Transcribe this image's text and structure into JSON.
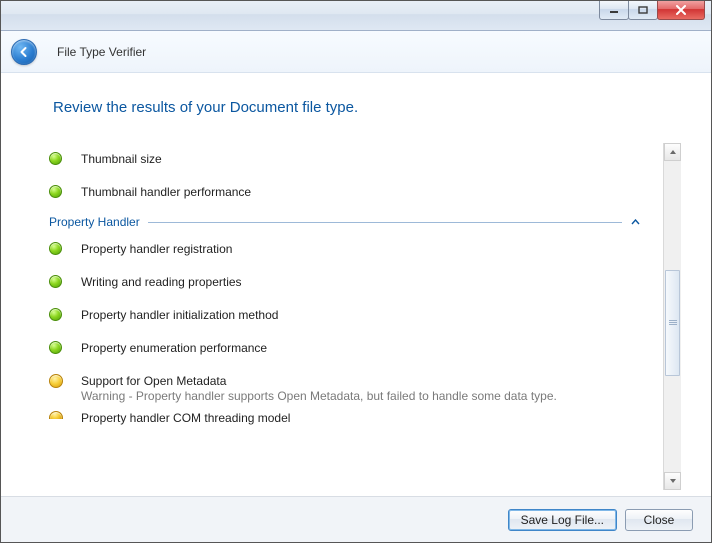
{
  "window": {
    "app_title": "File Type Verifier"
  },
  "page": {
    "heading": "Review the results of your Document file type."
  },
  "results": {
    "pre_section": [
      {
        "status": "ok",
        "title": "Thumbnail size"
      },
      {
        "status": "ok",
        "title": "Thumbnail handler performance"
      }
    ],
    "section": {
      "label": "Property Handler",
      "expanded": true
    },
    "items": [
      {
        "status": "ok",
        "title": "Property handler registration"
      },
      {
        "status": "ok",
        "title": "Writing and reading properties"
      },
      {
        "status": "ok",
        "title": "Property handler initialization method"
      },
      {
        "status": "ok",
        "title": "Property enumeration performance"
      },
      {
        "status": "warn",
        "title": "Support for Open Metadata",
        "sub": "Warning - Property handler supports Open Metadata, but failed to handle some data type."
      },
      {
        "status": "warn_clip",
        "title": "Property handler COM threading model"
      }
    ]
  },
  "footer": {
    "save_label": "Save Log File...",
    "close_label": "Close"
  }
}
